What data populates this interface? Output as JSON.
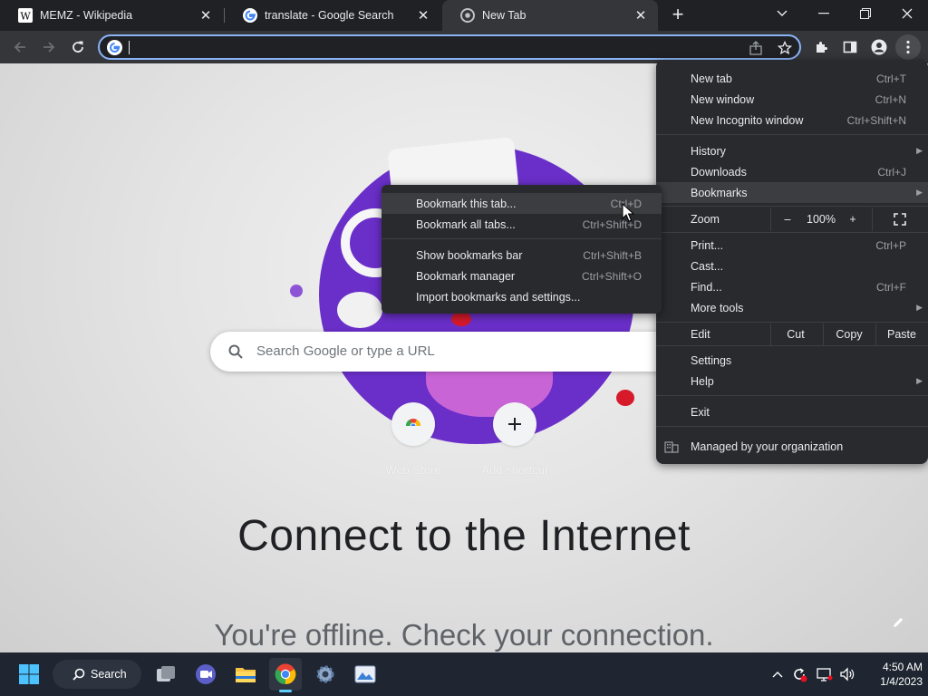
{
  "tabs": [
    {
      "title": "MEMZ - Wikipedia",
      "icon": "wikipedia-icon",
      "active": false
    },
    {
      "title": "translate - Google Search",
      "icon": "google-icon",
      "active": false
    },
    {
      "title": "New Tab",
      "icon": "chrome-icon",
      "active": true
    }
  ],
  "omnibox": {
    "value": ""
  },
  "ntp": {
    "search_placeholder": "Search Google or type a URL",
    "shortcuts": [
      {
        "label": "Web Store",
        "icon": "chrome-web-store-icon"
      },
      {
        "label": "Add shortcut",
        "icon": "plus-icon"
      }
    ],
    "offline_title": "Connect to the Internet",
    "offline_subtitle": "You're offline. Check your connection."
  },
  "main_menu": {
    "new_tab": {
      "label": "New tab",
      "shortcut": "Ctrl+T"
    },
    "new_window": {
      "label": "New window",
      "shortcut": "Ctrl+N"
    },
    "new_incognito": {
      "label": "New Incognito window",
      "shortcut": "Ctrl+Shift+N"
    },
    "history": {
      "label": "History"
    },
    "downloads": {
      "label": "Downloads",
      "shortcut": "Ctrl+J"
    },
    "bookmarks": {
      "label": "Bookmarks"
    },
    "zoom": {
      "label": "Zoom",
      "minus": "–",
      "level": "100%",
      "plus": "+"
    },
    "print": {
      "label": "Print...",
      "shortcut": "Ctrl+P"
    },
    "cast": {
      "label": "Cast..."
    },
    "find": {
      "label": "Find...",
      "shortcut": "Ctrl+F"
    },
    "more_tools": {
      "label": "More tools"
    },
    "edit": {
      "label": "Edit",
      "cut": "Cut",
      "copy": "Copy",
      "paste": "Paste"
    },
    "settings": {
      "label": "Settings"
    },
    "help": {
      "label": "Help"
    },
    "exit": {
      "label": "Exit"
    },
    "managed": {
      "label": "Managed by your organization"
    }
  },
  "bookmarks_menu": {
    "items": [
      {
        "label": "Bookmark this tab...",
        "shortcut": "Ctrl+D"
      },
      {
        "label": "Bookmark all tabs...",
        "shortcut": "Ctrl+Shift+D"
      },
      {
        "label": "Show bookmarks bar",
        "shortcut": "Ctrl+Shift+B"
      },
      {
        "label": "Bookmark manager",
        "shortcut": "Ctrl+Shift+O"
      },
      {
        "label": "Import bookmarks and settings...",
        "shortcut": ""
      }
    ]
  },
  "taskbar": {
    "search_label": "Search",
    "apps": [
      "task-view-icon",
      "meet-icon",
      "file-explorer-icon",
      "chrome-icon",
      "settings-icon",
      "photos-icon"
    ],
    "time": "4:50 AM",
    "date": "1/4/2023"
  },
  "colors": {
    "accent": "#8ab4f8",
    "menu_bg": "#292a2d",
    "tabstrip_bg": "#202124",
    "toolbar_bg": "#35363a",
    "taskbar_bg": "#1f2631",
    "logo_purple": "#6a2fc9"
  }
}
